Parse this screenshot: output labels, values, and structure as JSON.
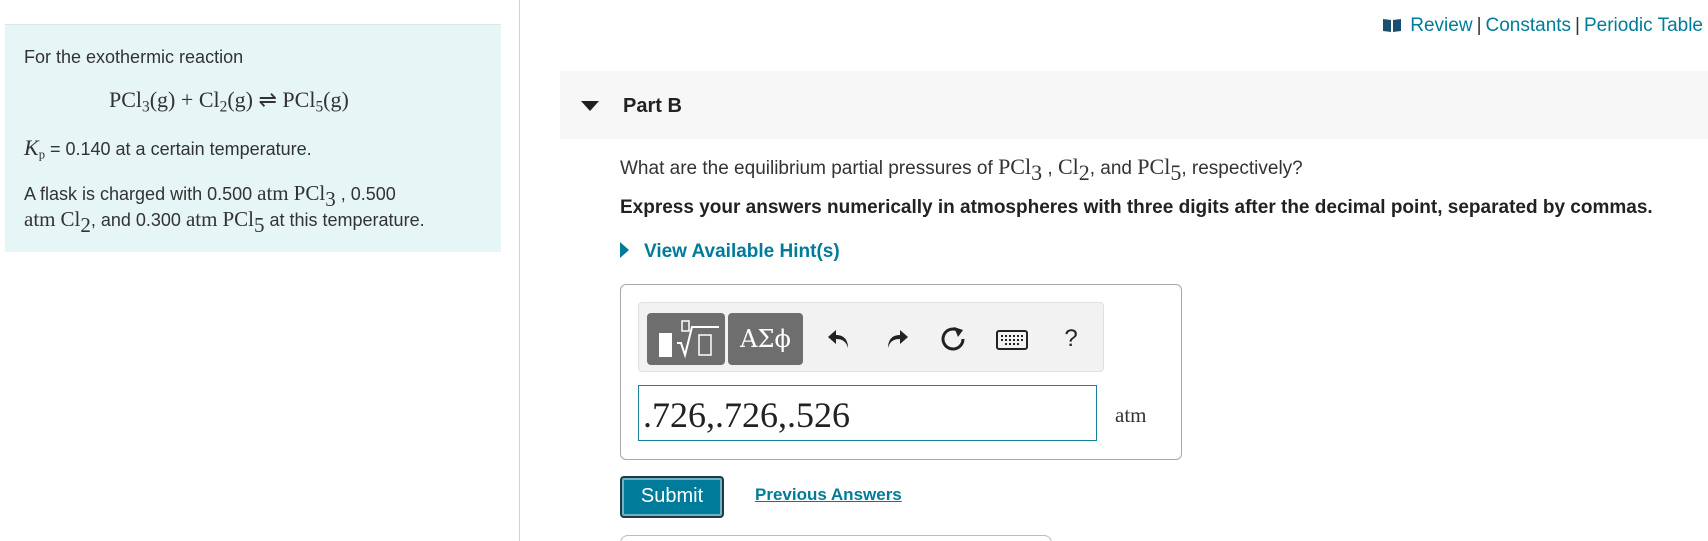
{
  "problem": {
    "intro": "For the exothermic reaction",
    "equation": {
      "reactant1": "PCl",
      "reactant1_sub": "3",
      "phase1": "(g)",
      "plus": "+",
      "reactant2": "Cl",
      "reactant2_sub": "2",
      "phase2": "(g)",
      "arrow": "⇌",
      "product": "PCl",
      "product_sub": "5",
      "phase3": "(g)"
    },
    "kp_symbol": "K",
    "kp_sub": "p",
    "kp_rest": " = 0.140 at a certain temperature.",
    "flask_1": "A flask is charged with 0.500 ",
    "flask_atm": "atm",
    "flask_pcl": "PCl",
    "flask_pcl_sub": "3",
    "flask_2": " , 0.500",
    "flask_atm2": "atm",
    "flask_cl": "Cl",
    "flask_cl_sub": "2",
    "flask_3": ", and 0.300 ",
    "flask_atm3": "atm",
    "flask_pcl5": "PCl",
    "flask_pcl5_sub": "5",
    "flask_4": " at this temperature."
  },
  "top_links": {
    "review": "Review",
    "sep1": "|",
    "constants": "Constants",
    "sep2": "|",
    "periodic_table": "Periodic Table"
  },
  "part": {
    "title": "Part B"
  },
  "question": {
    "prefix": "What are the equilibrium partial pressures of ",
    "s1": "PCl",
    "s1_sub": "3",
    "mid1": " , ",
    "s2": "Cl",
    "s2_sub": "2",
    "mid2": ", and ",
    "s3": "PCl",
    "s3_sub": "5",
    "suffix": ", respectively?"
  },
  "instructions": "Express your answers numerically in atmospheres with three digits after the decimal point, separated by commas.",
  "hint_label": "View Available Hint(s)",
  "toolbar": {
    "greek_label": "ΑΣϕ",
    "undo_icon": "undo-icon",
    "redo_icon": "redo-icon",
    "reset_icon": "reset-icon",
    "keyboard_icon": "keyboard-icon",
    "help_label": "?"
  },
  "answer": {
    "value": ".726,.726,.526",
    "unit": "atm"
  },
  "buttons": {
    "submit": "Submit",
    "previous_answers": "Previous Answers"
  },
  "colors": {
    "accent": "#007c9a",
    "panel_bg": "#e6f5f5",
    "header_bg": "#f7f7f7",
    "toolbar_grey": "#6e6e6e"
  }
}
